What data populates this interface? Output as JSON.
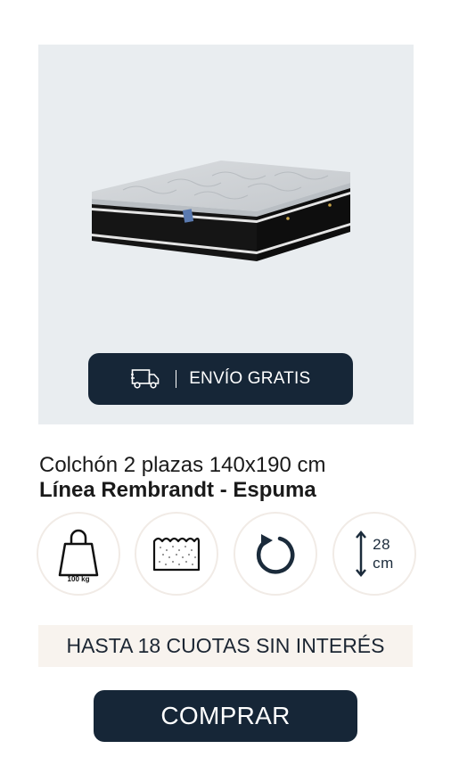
{
  "product": {
    "title": "Colchón 2 plazas 140x190 cm",
    "subtitle": "Línea Rembrandt - Espuma"
  },
  "shipping": {
    "label": "ENVÍO GRATIS",
    "icon": "truck-icon"
  },
  "features": [
    {
      "icon": "weight-icon",
      "text": "100 kg"
    },
    {
      "icon": "foam-icon"
    },
    {
      "icon": "rotate-icon"
    },
    {
      "icon": "height-icon",
      "value": "28",
      "unit": "cm"
    }
  ],
  "promo": {
    "installments": "HASTA 18 CUOTAS SIN INTERÉS"
  },
  "cta": {
    "buy_label": "COMPRAR"
  },
  "colors": {
    "navy": "#162637",
    "image_bg": "#e9edf0",
    "banner_bg": "#f8f3ee",
    "circle_border": "#f1ebe6"
  }
}
